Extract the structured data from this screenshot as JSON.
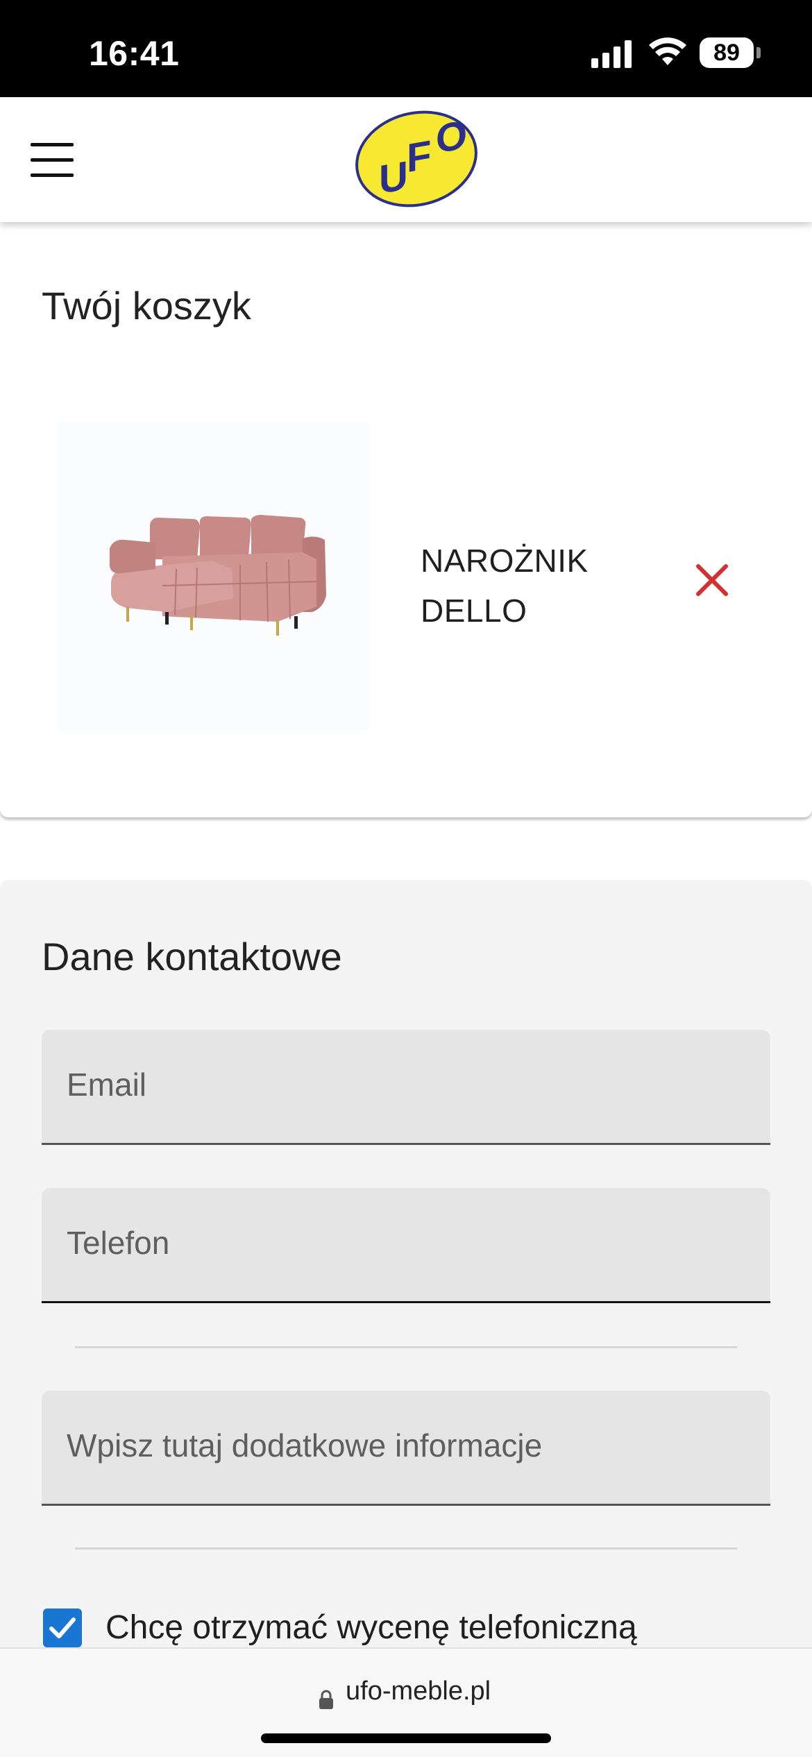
{
  "status_bar": {
    "time": "16:41",
    "battery": "89"
  },
  "header": {
    "logo_text": "UFO",
    "icons": [
      "hamburger-menu-icon",
      "ufo-logo"
    ]
  },
  "cart": {
    "title": "Twój koszyk",
    "items": [
      {
        "name": "NAROŻNIK DELLO",
        "image": "pink-corner-sofa"
      }
    ]
  },
  "contact": {
    "title": "Dane kontaktowe",
    "email_placeholder": "Email",
    "phone_placeholder": "Telefon",
    "info_placeholder": "Wpisz tutaj dodatkowe informacje",
    "checkbox_label": "Chcę otrzymać wycenę telefoniczną",
    "checkbox_checked": true
  },
  "browser": {
    "url": "ufo-meble.pl"
  },
  "colors": {
    "remove_icon": "#d32f2f",
    "checkbox": "#1976d2",
    "logo_yellow": "#f7e932",
    "logo_blue": "#2b2f8c",
    "sofa": "#c98a87"
  }
}
